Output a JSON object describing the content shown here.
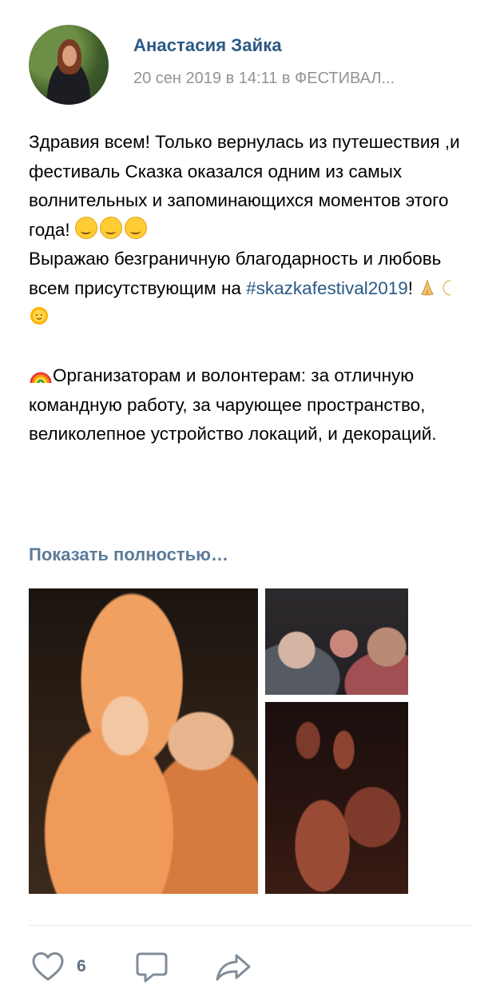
{
  "post": {
    "author": "Анастасия Зайка",
    "date": "20 сен 2019 в 14:11 в ФЕСТИВАЛ...",
    "text": {
      "p1": "Здравия всем! Только вернулась из путешествия ,и фестиваль Сказка оказался одним из самых волнительных и запоминающихся моментов этого года!",
      "p2": "Выражаю безграничную благодарность и любовь всем присутствующим на",
      "hashtag": "#skazkafestival2019",
      "p2_end": "!",
      "p3": "Организаторам и волонтерам: за отличную командную работу, за чарующее пространство, великолепное устройство локаций, и декораций."
    },
    "show_more": "Показать полностью…",
    "emojis": [
      "smiling-face",
      "upside-down-face",
      "hugging-face",
      "folded-hands",
      "crescent-moon",
      "sun-with-face",
      "rainbow"
    ],
    "photos": [
      "main-photo",
      "group-photo",
      "campfire-photo"
    ]
  },
  "actions": {
    "like_count": "6",
    "icons": [
      "heart-icon",
      "comment-icon",
      "share-icon"
    ]
  },
  "colors": {
    "link": "#2a5885",
    "muted": "#939393",
    "show_more": "#5d7b99",
    "icon": "#5e6e80"
  }
}
